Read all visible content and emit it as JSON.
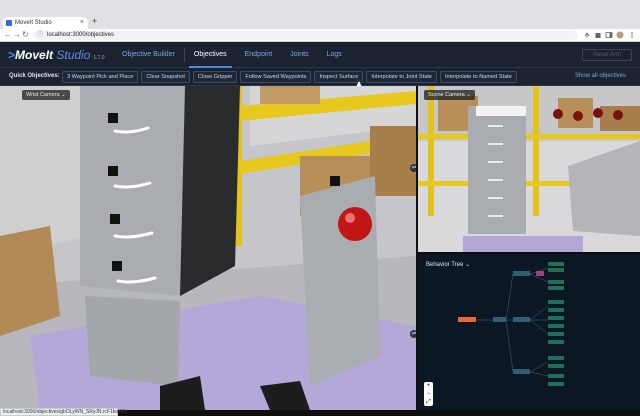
{
  "browser": {
    "tab_title": "MoveIt Studio",
    "tab_close": "×",
    "new_tab": "+",
    "url": "localhost:3000/objectives",
    "status_url": "localhost:3000/objectives/gbOLyWN_SRyJN.rcF1kuWA"
  },
  "header": {
    "logo_chev": ">",
    "logo_main": "MoveIt",
    "logo_studio": " Studio",
    "version": "1.7.0",
    "nav": [
      {
        "label": "Objective Builder"
      },
      {
        "label": "Objectives"
      },
      {
        "label": "Endpoint"
      },
      {
        "label": "Joints"
      },
      {
        "label": "Logs"
      }
    ],
    "reset_label": "Reset Arm"
  },
  "quick_objectives": {
    "label": "Quick Objectives:",
    "buttons": [
      {
        "label": "3 Waypoint Pick and Place"
      },
      {
        "label": "Clear Snapshot"
      },
      {
        "label": "Close Gripper"
      },
      {
        "label": "Follow Saved Waypoints"
      },
      {
        "label": "Inspect Surface"
      },
      {
        "label": "Interpolate to Joint State"
      },
      {
        "label": "Interpolate to Named State"
      }
    ],
    "show_all": "Show all objectives"
  },
  "views": {
    "main_camera": "Wrist Camera",
    "scene_camera": "Scene Camera",
    "behavior_tree": "Behavior Tree",
    "dropdown": "⌄",
    "swap": "⇄"
  },
  "zoom": {
    "plus": "+",
    "minus": "−",
    "fit": "⤢"
  },
  "colors": {
    "header_bg": "#1b2330",
    "accent": "#4c8ae8",
    "cabinet": "#a9acb1",
    "rack": "#e4c21a",
    "floor": "#b7a9d6",
    "box": "#b9905a"
  }
}
